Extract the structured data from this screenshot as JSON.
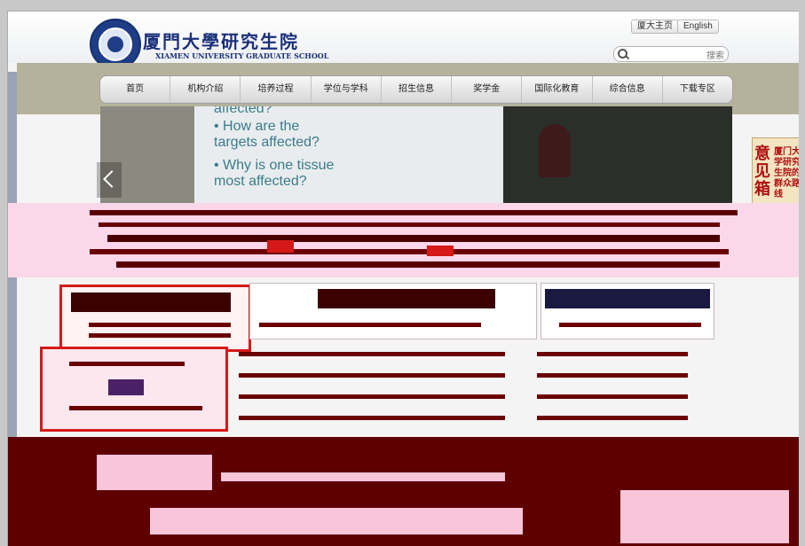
{
  "header": {
    "logo_cn": "厦門大學研究生院",
    "logo_en": "XIAMEN UNIVERSITY  GRADUATE SCHOOL",
    "links": [
      "厦大主页",
      "English"
    ],
    "search_button": "搜索",
    "search_placeholder": ""
  },
  "nav": {
    "items": [
      "首页",
      "机构介绍",
      "培养过程",
      "学位与学科",
      "招生信息",
      "奖学金",
      "国际化教育",
      "综合信息",
      "下载专区"
    ]
  },
  "banner": {
    "slide_lines": [
      "affected?",
      "• How are the",
      "  targets affected?",
      "• Why is one tissue",
      "  most affected?"
    ]
  },
  "poster": {
    "big_text": "意见箱",
    "small_text": "厦门大学研究生院的群众路线"
  },
  "colors": {
    "nav_bg": "#e6e6e6",
    "accent_red": "#d51919",
    "dark_maroon": "#5f0000",
    "pink": "#fbd7ea",
    "brand_blue": "#1a2f7a"
  }
}
